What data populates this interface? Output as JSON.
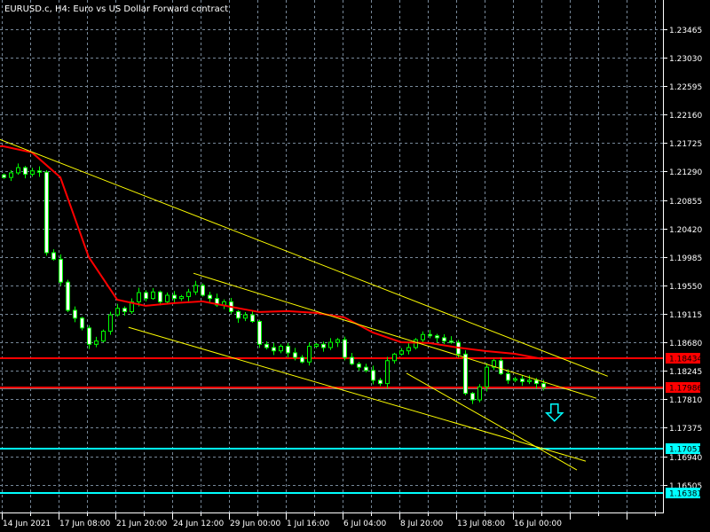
{
  "header": {
    "title": "EURUSD.c, H4:  Euro vs US Dollar Forward contract"
  },
  "colors": {
    "background": "#000000",
    "grid": "#778899",
    "bull_outline": "#00ff00",
    "bear_body": "#ffffff",
    "ma": "#ff0000",
    "trendline": "#ffff00",
    "resistance": "#ff0000",
    "support": "#00ffff",
    "ask_line": "#808080",
    "arrow": "#00ffff"
  },
  "chart_data": {
    "type": "candlestick",
    "symbol": "EURUSD.c",
    "timeframe": "H4",
    "price_ticks": [
      "1.23465",
      "1.23030",
      "1.22595",
      "1.22160",
      "1.21725",
      "1.21290",
      "1.20855",
      "1.20420",
      "1.19985",
      "1.19550",
      "1.19115",
      "1.18680",
      "1.18245",
      "1.17810",
      "1.17375",
      "1.16940",
      "1.16505"
    ],
    "ylim": [
      1.1615,
      1.2452
    ],
    "time_labels": [
      "14 Jun 2021",
      "17 Jun 08:00",
      "21 Jun 20:00",
      "24 Jun 12:00",
      "29 Jun 00:00",
      "1 Jul 16:00",
      "6 Jul 04:00",
      "8 Jul 20:00",
      "13 Jul 08:00",
      "16 Jul 00:00"
    ],
    "closes": [
      1.212,
      1.2127,
      1.2135,
      1.2125,
      1.213,
      1.2128,
      1.2005,
      1.1995,
      1.196,
      1.1917,
      1.1905,
      1.189,
      1.1865,
      1.187,
      1.1885,
      1.191,
      1.192,
      1.1915,
      1.193,
      1.1944,
      1.1935,
      1.1945,
      1.193,
      1.194,
      1.1935,
      1.1938,
      1.1945,
      1.1955,
      1.194,
      1.1935,
      1.1925,
      1.193,
      1.1915,
      1.1905,
      1.191,
      1.19,
      1.1865,
      1.186,
      1.1855,
      1.1862,
      1.1852,
      1.1845,
      1.1838,
      1.1862,
      1.1865,
      1.186,
      1.1868,
      1.1872,
      1.1845,
      1.1835,
      1.183,
      1.1825,
      1.181,
      1.1805,
      1.184,
      1.185,
      1.1855,
      1.186,
      1.1872,
      1.188,
      1.1878,
      1.1875,
      1.187,
      1.1868,
      1.185,
      1.179,
      1.178,
      1.18,
      1.183,
      1.184,
      1.182,
      1.181,
      1.1812,
      1.1808,
      1.181,
      1.1805,
      1.1799
    ],
    "moving_average": [
      1.21676,
      1.21582,
      1.21202,
      1.19983,
      1.19332,
      1.19238,
      1.19279,
      1.19306,
      1.19224,
      1.19143,
      1.19157,
      1.1913,
      1.19062,
      1.18831,
      1.18682,
      1.18669,
      1.186,
      1.18546,
      1.18505,
      1.18424
    ],
    "trendlines": [
      {
        "from": [
          -0.5,
          1.2178
        ],
        "to": [
          85.1,
          1.18162
        ]
      },
      {
        "from": [
          26.75,
          1.19736
        ],
        "to": [
          83.5,
          1.17825
        ]
      },
      {
        "from": [
          17.6,
          1.1891
        ],
        "to": [
          82,
          1.16864
        ]
      },
      {
        "from": [
          56.75,
          1.18208
        ],
        "to": [
          80.75,
          1.16729
        ]
      }
    ],
    "levels": [
      {
        "price": 1.18434,
        "label": "1.18434",
        "kind": "resistance"
      },
      {
        "price": 1.17986,
        "label": "1.17986",
        "kind": "resistance"
      },
      {
        "price": 1.17051,
        "label": "1.17051",
        "kind": "support"
      },
      {
        "price": 1.16381,
        "label": "1.16381",
        "kind": "support"
      }
    ],
    "ask_price": 1.1797,
    "signal": {
      "direction": "sell",
      "bar": 77.6,
      "price": 1.176
    }
  }
}
